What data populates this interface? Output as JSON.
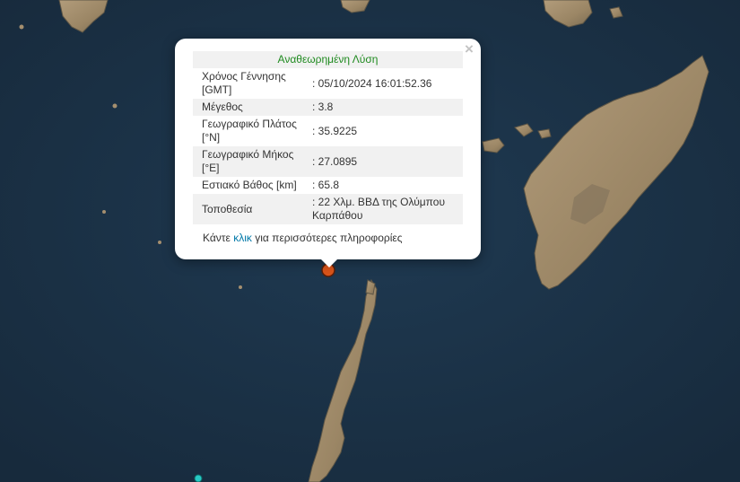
{
  "popup": {
    "title": "Αναθεωρημένη Λύση",
    "close_symbol": "×",
    "rows": [
      {
        "label": "Χρόνος Γέννησης [GMT]",
        "value": ": 05/10/2024 16:01:52.36"
      },
      {
        "label": "Μέγεθος",
        "value": ": 3.8"
      },
      {
        "label": "Γεωγραφικό Πλάτος [°N]",
        "value": ": 35.9225"
      },
      {
        "label": "Γεωγραφικό Μήκος [°E]",
        "value": ": 27.0895"
      },
      {
        "label": "Εστιακό Βάθος [km]",
        "value": ": 65.8"
      },
      {
        "label": "Τοποθεσία",
        "value": ": 22 Χλμ. ΒΒΔ της Ολύμπου Καρπάθου"
      }
    ],
    "more_prefix": "Κάντε ",
    "more_link": "κλικ",
    "more_suffix": " για περισσότερες πληροφορίες"
  },
  "markers": {
    "epicenter_color": "#d9541a",
    "secondary_color": "#27c9c4"
  },
  "map_colors": {
    "sea": "#1b3146",
    "land": "#a58f6f",
    "land_dark": "#6e6451"
  }
}
